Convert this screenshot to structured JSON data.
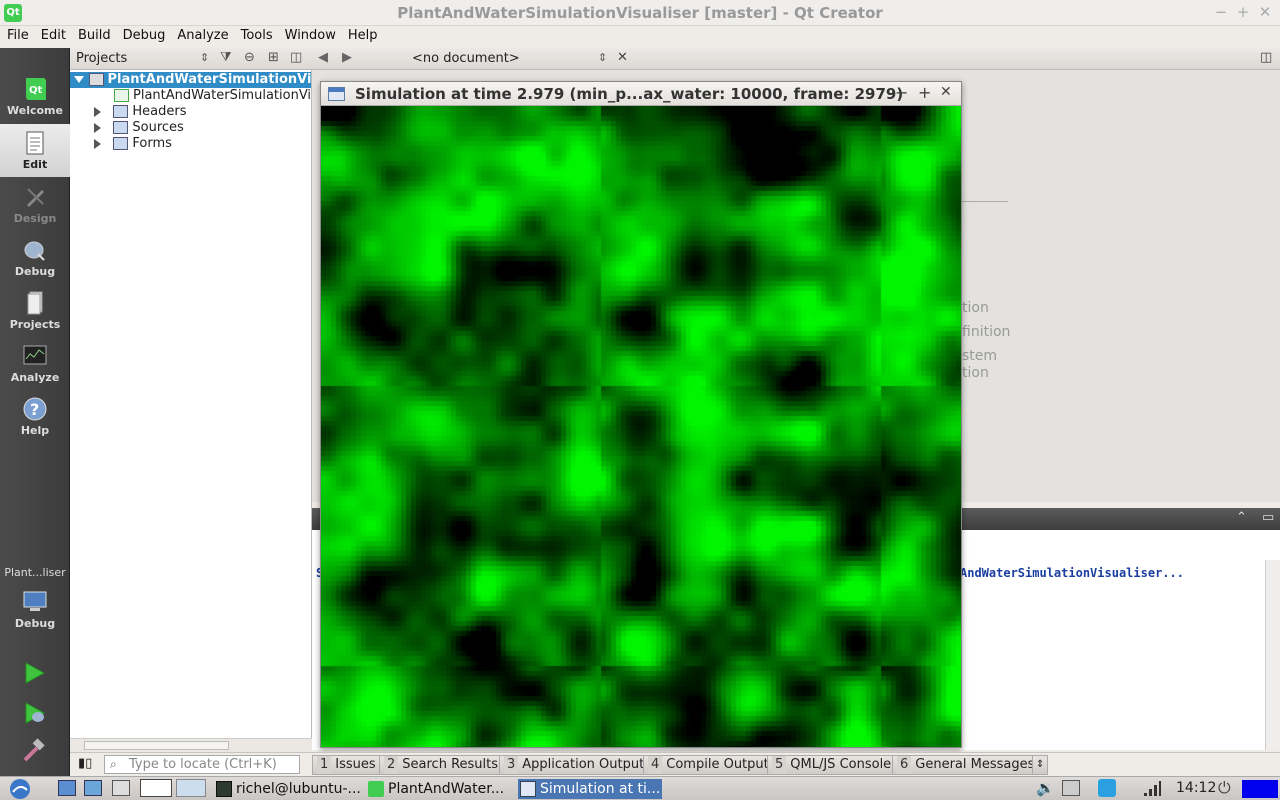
{
  "window": {
    "title": "PlantAndWaterSimulationVisualiser [master] - Qt Creator"
  },
  "menu": [
    "File",
    "Edit",
    "Build",
    "Debug",
    "Analyze",
    "Tools",
    "Window",
    "Help"
  ],
  "modes": [
    {
      "label": "Welcome",
      "icon": "qt-logo-icon"
    },
    {
      "label": "Edit",
      "icon": "document-icon"
    },
    {
      "label": "Design",
      "icon": "design-pen-icon"
    },
    {
      "label": "Debug",
      "icon": "debug-bug-icon"
    },
    {
      "label": "Projects",
      "icon": "projects-icon"
    },
    {
      "label": "Analyze",
      "icon": "analyze-icon"
    },
    {
      "label": "Help",
      "icon": "help-icon"
    }
  ],
  "kit": {
    "project": "Plant...liser",
    "config": "Debug"
  },
  "projects": {
    "selector": "Projects",
    "tree": [
      {
        "label": "PlantAndWaterSimulationVisualiser",
        "icon": "project-icon"
      },
      {
        "label": "PlantAndWaterSimulationVisualiser.pro",
        "icon": "pro-file-icon"
      },
      {
        "label": "Headers",
        "icon": "headers-folder-icon"
      },
      {
        "label": "Sources",
        "icon": "sources-folder-icon"
      },
      {
        "label": "Forms",
        "icon": "forms-folder-icon"
      }
    ]
  },
  "editor": {
    "document": "<no document>"
  },
  "background": {
    "hint1": "tion",
    "hint2": "finition",
    "hint3": "stem",
    "hint4": "tion",
    "output_prefix": "S",
    "output_text": "AndWaterSimulationVisualiser..."
  },
  "sim": {
    "title": "Simulation at time 2.979 (min_p...ax_water: 10000, frame: 2979)",
    "minimize": "−",
    "maximize": "+",
    "close": "✕"
  },
  "locator": {
    "placeholder": "Type to locate (Ctrl+K)"
  },
  "panes": [
    {
      "num": "1",
      "label": "Issues"
    },
    {
      "num": "2",
      "label": "Search Results"
    },
    {
      "num": "3",
      "label": "Application Output"
    },
    {
      "num": "4",
      "label": "Compile Output"
    },
    {
      "num": "5",
      "label": "QML/JS Console"
    },
    {
      "num": "6",
      "label": "General Messages"
    }
  ],
  "taskbar": {
    "tasks": [
      "richel@lubuntu-...",
      "PlantAndWater...",
      "Simulation at ti..."
    ],
    "clock": "14:12"
  },
  "colors": {
    "accent": "#308cc6",
    "plant": "#00ff00",
    "taskActive": "#4a76b4"
  }
}
